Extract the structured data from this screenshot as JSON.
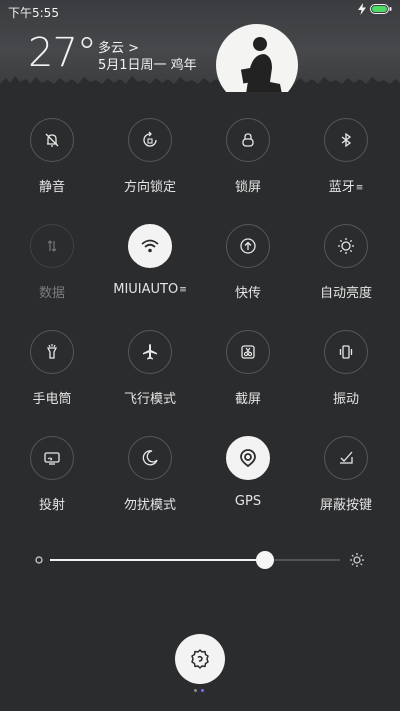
{
  "status_bar": {
    "time": "下午5:55",
    "battery_color": "#4cd964"
  },
  "weather": {
    "temperature": "27°",
    "condition": "多云 >",
    "date": "5月1日周一  鸡年"
  },
  "toggles": [
    {
      "label": "静音",
      "icon": "bell-off-icon",
      "state": "off"
    },
    {
      "label": "方向锁定",
      "icon": "rotation-lock-icon",
      "state": "off"
    },
    {
      "label": "锁屏",
      "icon": "lock-icon",
      "state": "off"
    },
    {
      "label": "蓝牙",
      "icon": "bluetooth-icon",
      "state": "off",
      "has_more": true
    },
    {
      "label": "数据",
      "icon": "mobile-data-icon",
      "state": "disabled"
    },
    {
      "label": "MIUIAUTO",
      "icon": "wifi-icon",
      "state": "on",
      "has_more": true
    },
    {
      "label": "快传",
      "icon": "quick-transfer-icon",
      "state": "off"
    },
    {
      "label": "自动亮度",
      "icon": "auto-brightness-icon",
      "state": "off"
    },
    {
      "label": "手电筒",
      "icon": "flashlight-icon",
      "state": "off"
    },
    {
      "label": "飞行模式",
      "icon": "airplane-icon",
      "state": "off"
    },
    {
      "label": "截屏",
      "icon": "screenshot-icon",
      "state": "off"
    },
    {
      "label": "振动",
      "icon": "vibrate-icon",
      "state": "off"
    },
    {
      "label": "投射",
      "icon": "cast-icon",
      "state": "off"
    },
    {
      "label": "勿扰模式",
      "icon": "moon-icon",
      "state": "off"
    },
    {
      "label": "GPS",
      "icon": "gps-icon",
      "state": "on"
    },
    {
      "label": "屏蔽按键",
      "icon": "block-keys-icon",
      "state": "off"
    }
  ],
  "brightness": {
    "level": 0.74
  },
  "page_indicator": {
    "current": 1,
    "total": 2,
    "active_color": "#7b6cff",
    "inactive_color": "#8a8a8a"
  },
  "colors": {
    "panel_bg": "#2b2c2e",
    "active_circle": "#f3f3f3"
  }
}
